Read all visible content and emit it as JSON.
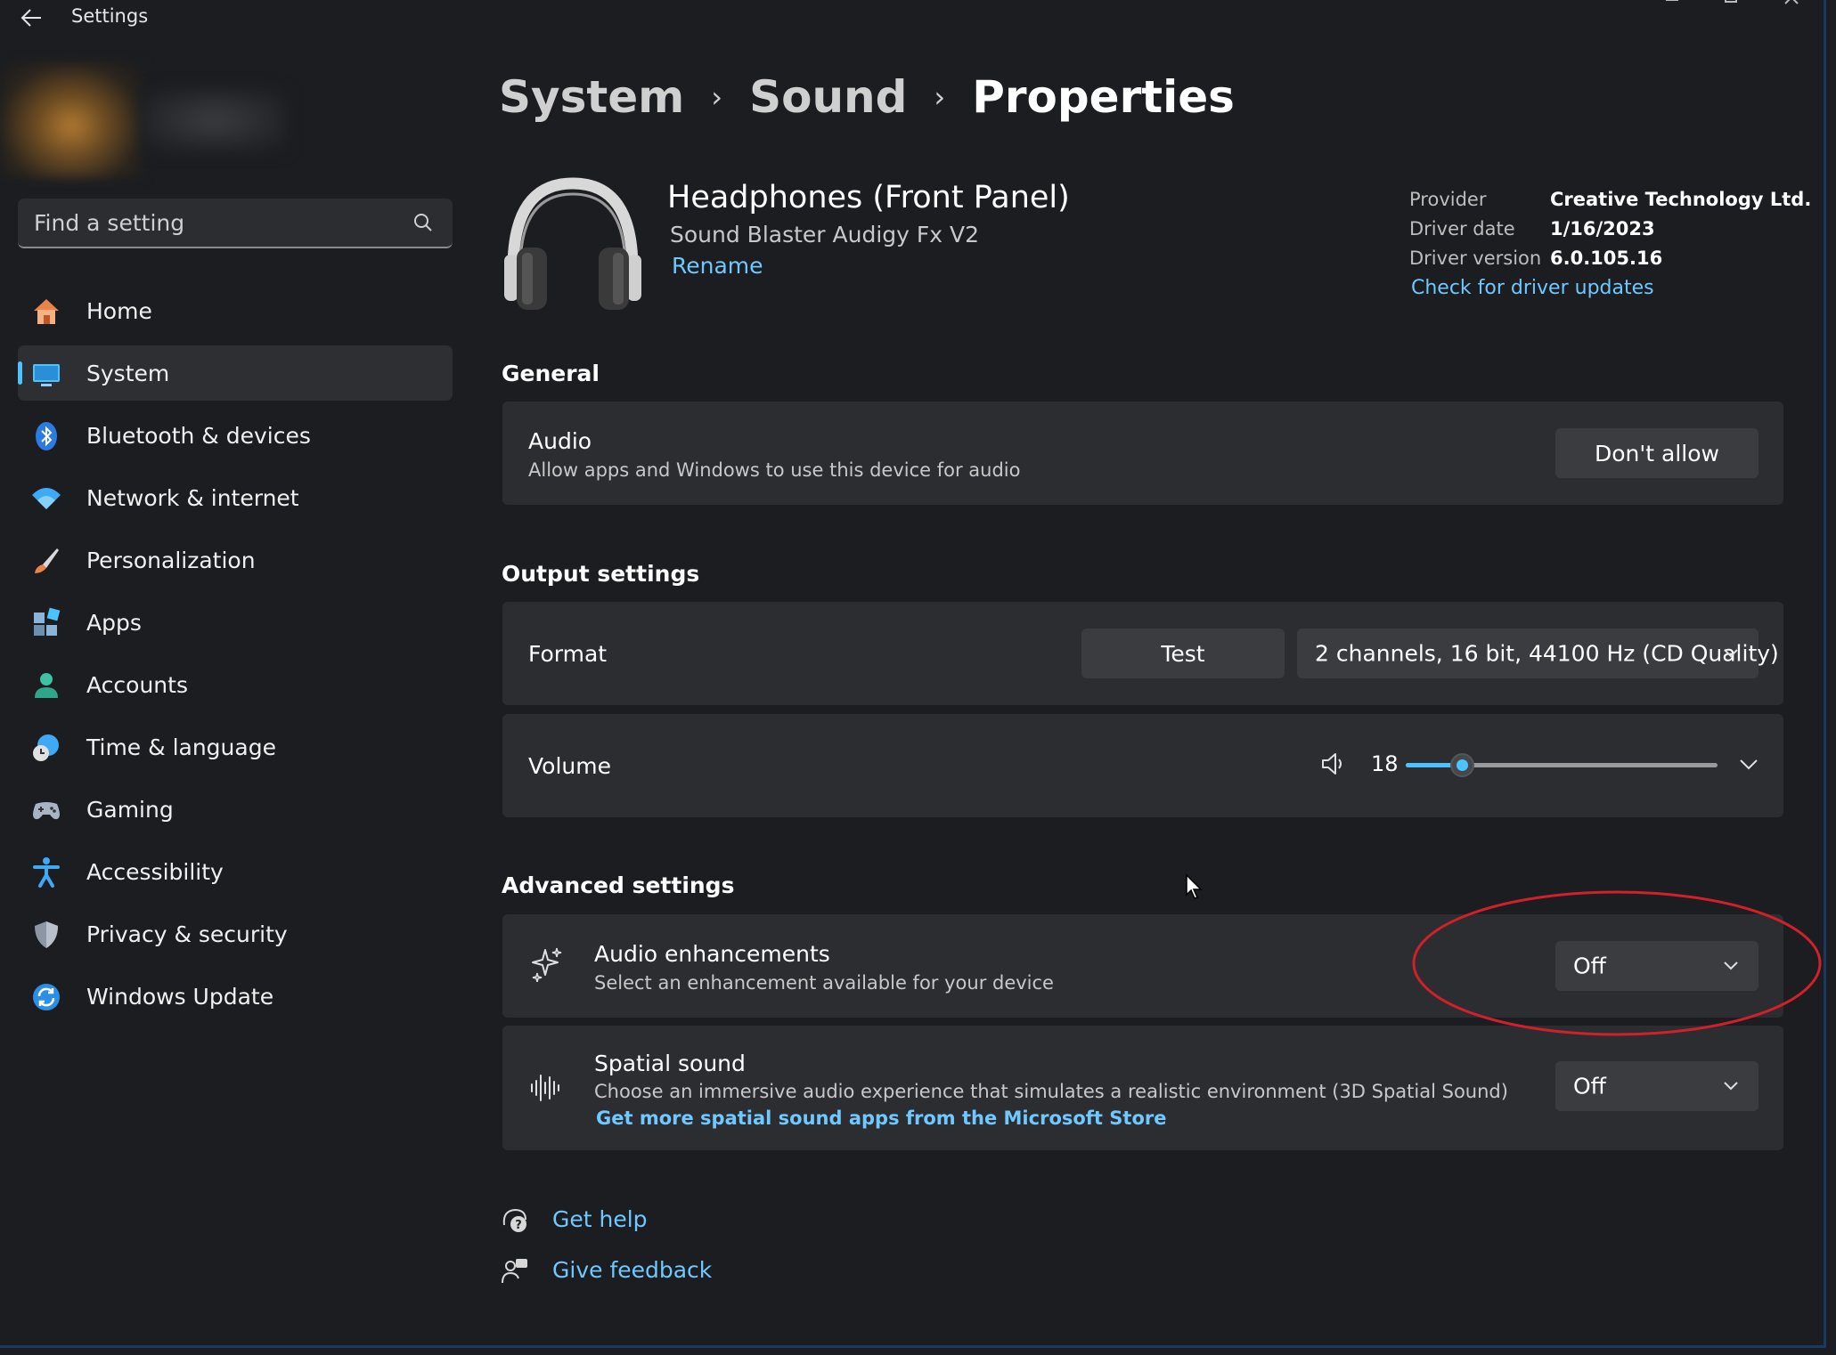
{
  "window": {
    "title": "Settings"
  },
  "search": {
    "placeholder": "Find a setting"
  },
  "nav": [
    {
      "label": "Home",
      "icon": "home-icon"
    },
    {
      "label": "System",
      "icon": "system-icon",
      "active": true
    },
    {
      "label": "Bluetooth & devices",
      "icon": "bluetooth-icon"
    },
    {
      "label": "Network & internet",
      "icon": "wifi-icon"
    },
    {
      "label": "Personalization",
      "icon": "brush-icon"
    },
    {
      "label": "Apps",
      "icon": "apps-icon"
    },
    {
      "label": "Accounts",
      "icon": "accounts-icon"
    },
    {
      "label": "Time & language",
      "icon": "clock-globe-icon"
    },
    {
      "label": "Gaming",
      "icon": "gamepad-icon"
    },
    {
      "label": "Accessibility",
      "icon": "accessibility-icon"
    },
    {
      "label": "Privacy & security",
      "icon": "shield-icon"
    },
    {
      "label": "Windows Update",
      "icon": "update-icon"
    }
  ],
  "breadcrumb": {
    "items": [
      "System",
      "Sound",
      "Properties"
    ]
  },
  "device": {
    "name": "Headphones (Front Panel)",
    "subtitle": "Sound Blaster Audigy Fx V2",
    "rename": "Rename"
  },
  "driver": {
    "provider_label": "Provider",
    "provider": "Creative Technology Ltd.",
    "date_label": "Driver date",
    "date": "1/16/2023",
    "version_label": "Driver version",
    "version": "6.0.105.16",
    "update_link": "Check for driver updates"
  },
  "general": {
    "title": "General",
    "audio_title": "Audio",
    "audio_desc": "Allow apps and Windows to use this device for audio",
    "audio_button": "Don't allow"
  },
  "output": {
    "title": "Output settings",
    "format_label": "Format",
    "test_button": "Test",
    "format_value": "2 channels, 16 bit, 44100 Hz (CD Quality)",
    "volume_label": "Volume",
    "volume_value": "18",
    "volume_fraction": 0.18
  },
  "advanced": {
    "title": "Advanced settings",
    "enh_title": "Audio enhancements",
    "enh_desc": "Select an enhancement available for your device",
    "enh_value": "Off",
    "spatial_title": "Spatial sound",
    "spatial_desc": "Choose an immersive audio experience that simulates a realistic environment (3D Spatial Sound)",
    "spatial_link": "Get more spatial sound apps from the Microsoft Store",
    "spatial_value": "Off"
  },
  "footer": {
    "help": "Get help",
    "feedback": "Give feedback"
  },
  "colors": {
    "accent": "#4cc2ff",
    "link": "#6fc8ff",
    "annotation": "#d0202a",
    "card": "#2b2d31",
    "background": "#1b1d20"
  }
}
